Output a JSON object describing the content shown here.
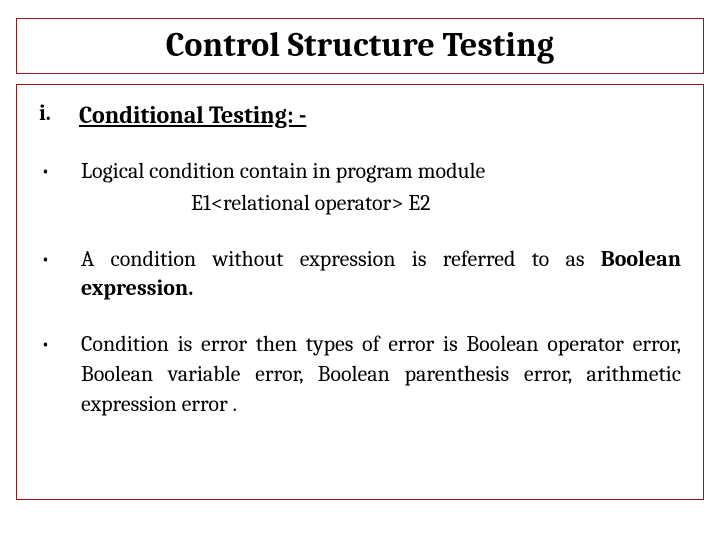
{
  "title": "Control Structure Testing",
  "heading_marker": "i.",
  "heading_text": "Conditional Testing: -",
  "bullets": [
    {
      "marker": "•",
      "text": "Logical condition contain in program module",
      "formula": "E1<relational operator> E2"
    },
    {
      "marker": "•",
      "prefix": "A condition without expression is referred to as ",
      "bold": "Boolean expression."
    },
    {
      "marker": "•",
      "text": "Condition is error then types of error is Boolean operator error, Boolean variable error, Boolean parenthesis error, arithmetic expression error ."
    }
  ]
}
